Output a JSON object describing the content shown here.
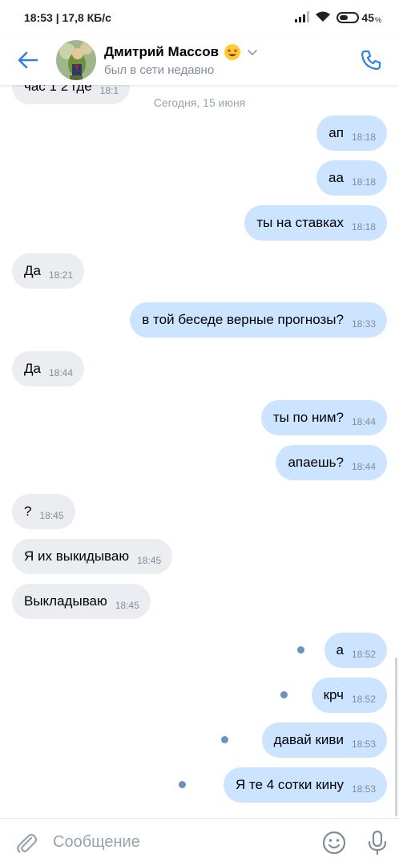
{
  "status_bar": {
    "time_speed": "18:53 | 17,8 КБ/с",
    "battery": "45",
    "battery_suffix": "%"
  },
  "header": {
    "contact_name": "Дмитрий Массов",
    "presence": "был в сети недавно",
    "icons": {
      "back": "back-arrow-icon",
      "call": "phone-icon",
      "chevron": "chevron-down-icon",
      "emoji": "star-struck-emoji-icon"
    }
  },
  "chat": {
    "partial_top": {
      "text": "час 1 2 где",
      "time": "18:1"
    },
    "date_separator": "Сегодня, 15 июня",
    "messages": [
      {
        "dir": "out",
        "text": "ап",
        "time": "18:18",
        "unread": false
      },
      {
        "dir": "out",
        "text": "аа",
        "time": "18:18",
        "unread": false
      },
      {
        "dir": "out",
        "text": "ты на ставках",
        "time": "18:18",
        "unread": false
      },
      {
        "dir": "in",
        "text": "Да",
        "time": "18:21",
        "unread": false
      },
      {
        "dir": "out",
        "text": "в той беседе верные прогнозы?",
        "time": "18:33",
        "unread": false
      },
      {
        "dir": "in",
        "text": "Да",
        "time": "18:44",
        "unread": false
      },
      {
        "dir": "out",
        "text": "ты по ним?",
        "time": "18:44",
        "unread": false
      },
      {
        "dir": "out",
        "text": "апаешь?",
        "time": "18:44",
        "unread": false
      },
      {
        "dir": "in",
        "text": "?",
        "time": "18:45",
        "unread": false
      },
      {
        "dir": "in",
        "text": "Я их выкидываю",
        "time": "18:45",
        "unread": false
      },
      {
        "dir": "in",
        "text": "Выкладываю",
        "time": "18:45",
        "unread": false
      },
      {
        "dir": "out",
        "text": "а",
        "time": "18:52",
        "unread": true
      },
      {
        "dir": "out",
        "text": "крч",
        "time": "18:52",
        "unread": true
      },
      {
        "dir": "out",
        "text": "давай киви",
        "time": "18:53",
        "unread": true
      },
      {
        "dir": "out",
        "text": "Я те 4 сотки кину",
        "time": "18:53",
        "unread": true
      }
    ]
  },
  "composer": {
    "placeholder": "Сообщение",
    "value": "",
    "icons": {
      "attach": "paperclip-icon",
      "emoji": "smiley-icon",
      "mic": "microphone-icon"
    }
  },
  "colors": {
    "accent": "#2d81e0",
    "incoming_bubble": "#ebedf0",
    "outgoing_bubble": "#cce4ff",
    "unread_dot": "#6a8fc2",
    "secondary_text": "#818c99"
  }
}
